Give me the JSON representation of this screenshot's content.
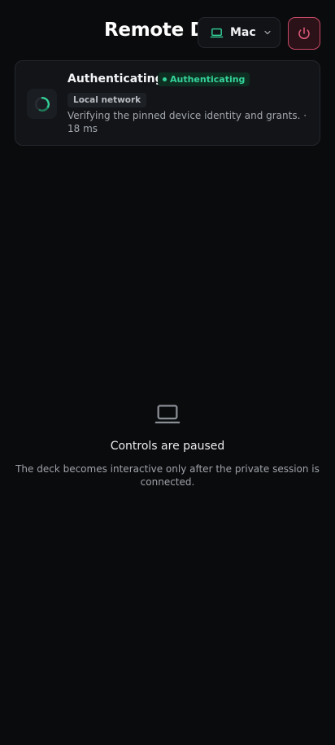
{
  "header": {
    "title": "Remote Deck",
    "device_select": {
      "selected": "Mac",
      "icon": "laptop-icon"
    },
    "power_icon": "power-icon"
  },
  "status_card": {
    "title": "Authenticating",
    "badge": "Authenticating",
    "network": "Local network",
    "description": "Verifying the pinned device identity and grants. · 18 ms",
    "colors": {
      "accent": "#34d399",
      "danger": "#c74a66"
    }
  },
  "empty_state": {
    "icon": "laptop-icon",
    "title": "Controls are paused",
    "description": "The deck becomes interactive only after the private session is connected."
  }
}
